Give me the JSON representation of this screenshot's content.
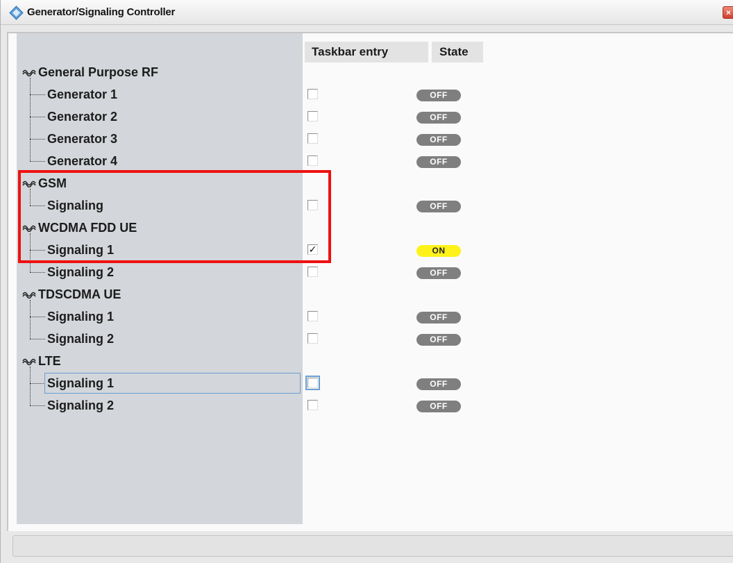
{
  "window": {
    "title": "Generator/Signaling Controller",
    "close_symbol": "×"
  },
  "columns": {
    "taskbar_entry": "Taskbar entry",
    "state": "State"
  },
  "groups": [
    {
      "name": "General Purpose RF",
      "items": [
        {
          "label": "Generator 1",
          "taskbar": false,
          "state": "OFF"
        },
        {
          "label": "Generator 2",
          "taskbar": false,
          "state": "OFF"
        },
        {
          "label": "Generator 3",
          "taskbar": false,
          "state": "OFF"
        },
        {
          "label": "Generator 4",
          "taskbar": false,
          "state": "OFF"
        }
      ]
    },
    {
      "name": "GSM",
      "items": [
        {
          "label": "Signaling",
          "taskbar": false,
          "state": "OFF"
        }
      ]
    },
    {
      "name": "WCDMA FDD UE",
      "items": [
        {
          "label": "Signaling 1",
          "taskbar": true,
          "state": "ON"
        },
        {
          "label": "Signaling 2",
          "taskbar": false,
          "state": "OFF"
        }
      ]
    },
    {
      "name": "TDSCDMA UE",
      "items": [
        {
          "label": "Signaling 1",
          "taskbar": false,
          "state": "OFF"
        },
        {
          "label": "Signaling 2",
          "taskbar": false,
          "state": "OFF"
        }
      ]
    },
    {
      "name": "LTE",
      "items": [
        {
          "label": "Signaling 1",
          "taskbar": false,
          "state": "OFF",
          "selected": true
        },
        {
          "label": "Signaling 2",
          "taskbar": false,
          "state": "OFF"
        }
      ]
    }
  ],
  "colors": {
    "state_on": "#fff21a",
    "state_off": "#7f7f7f",
    "highlight": "#ee1111",
    "selection": "#6a9fd4"
  },
  "icons": {
    "title": "rohde-schwarz-logo-icon",
    "group": "wave-icon",
    "close": "close-icon"
  }
}
